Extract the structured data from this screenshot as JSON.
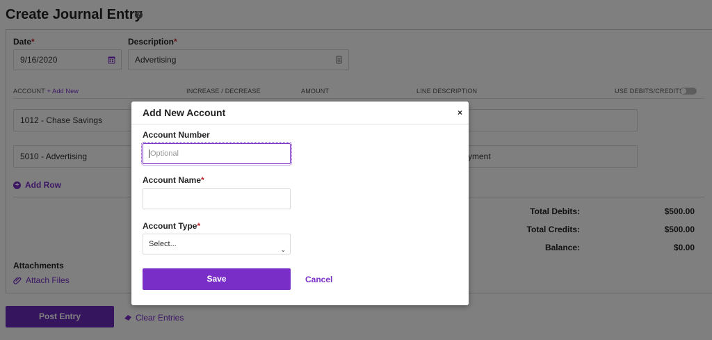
{
  "page": {
    "title": "Create Journal Entry",
    "help_icon": "?"
  },
  "form": {
    "date_label": "Date",
    "date_value": "9/16/2020",
    "description_label": "Description",
    "description_value": "Advertising",
    "required_mark": "*"
  },
  "columns": {
    "account": "ACCOUNT",
    "add_new": "+ Add New",
    "increase_decrease": "INCREASE / DECREASE",
    "amount": "AMOUNT",
    "line_description": "LINE DESCRIPTION",
    "use_debits_credits": "USE DEBITS/CREDITS"
  },
  "lines": [
    {
      "account": "1012 - Chase Savings",
      "line_description": ""
    },
    {
      "account": "5010 - Advertising",
      "line_description_partial": "yment"
    }
  ],
  "add_row_label": "Add Row",
  "totals": {
    "debits_label": "Total Debits:",
    "debits_value": "$500.00",
    "credits_label": "Total Credits:",
    "credits_value": "$500.00",
    "balance_label": "Balance:",
    "balance_value": "$0.00"
  },
  "attachments": {
    "title": "Attachments",
    "link": "Attach Files"
  },
  "actions": {
    "post_entry": "Post Entry",
    "clear_entries": "Clear Entries"
  },
  "modal": {
    "title": "Add New Account",
    "close": "×",
    "account_number_label": "Account Number",
    "account_number_placeholder": "Optional",
    "account_name_label": "Account Name",
    "account_name_value": "",
    "account_type_label": "Account Type",
    "account_type_value": "Select...",
    "save": "Save",
    "cancel": "Cancel"
  },
  "colors": {
    "accent": "#7a2ec8",
    "required": "#c0262d"
  }
}
